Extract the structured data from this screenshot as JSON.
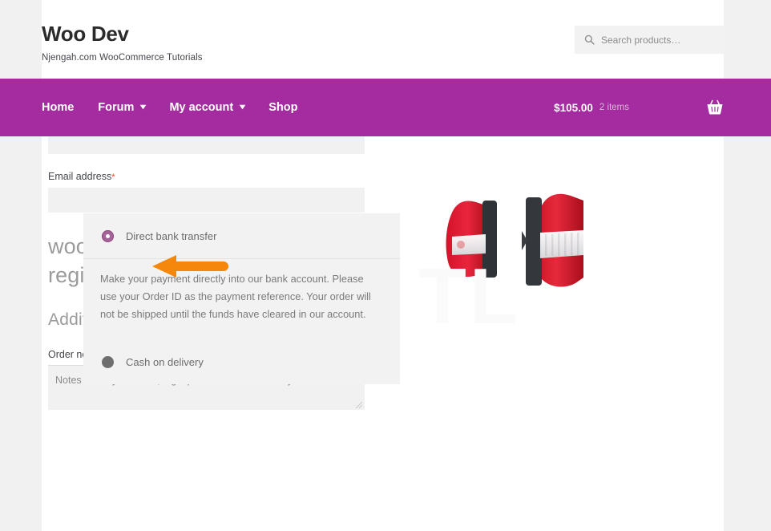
{
  "header": {
    "site_title": "Woo Dev",
    "tagline": "Njengah.com WooCommerce Tutorials",
    "search": {
      "placeholder": "Search products…",
      "icon": "search-icon"
    }
  },
  "nav": {
    "background_color": "#a42ba0",
    "items": [
      {
        "label": "Home",
        "has_dropdown": false
      },
      {
        "label": "Forum",
        "has_dropdown": true,
        "chevron": "▾"
      },
      {
        "label": "My account",
        "has_dropdown": true,
        "chevron": "▾"
      },
      {
        "label": "Shop",
        "has_dropdown": false
      }
    ],
    "cart": {
      "amount": "$105.00",
      "count": "2 items",
      "icon": "shopping-basket-icon"
    }
  },
  "checkout": {
    "email_label": "Email address",
    "required_mark": "*",
    "email_value": "",
    "hook_name": "woocommerce_after_checkout_registration_form",
    "additional_info_heading": "Additional information",
    "order_notes_label": "Order notes (optional)",
    "order_notes_placeholder": "Notes about your order, e.g. special notes for delivery.",
    "order_notes_value": ""
  },
  "annotation": {
    "type": "left-arrow",
    "color": "#f5880c"
  },
  "payment": {
    "options": [
      {
        "label": "Direct bank transfer",
        "selected": true,
        "description": "Make your payment directly into our bank account. Please use your Order ID as the payment reference. Your order will not be shipped until the funds have cleared in our account."
      },
      {
        "label": "Cash on delivery",
        "selected": false,
        "description": ""
      }
    ],
    "selected_color": "#a46497",
    "unselected_color": "#6e6e6e"
  },
  "product": {
    "image_alt": "car tail lights pair",
    "watermark_text": "TL"
  }
}
